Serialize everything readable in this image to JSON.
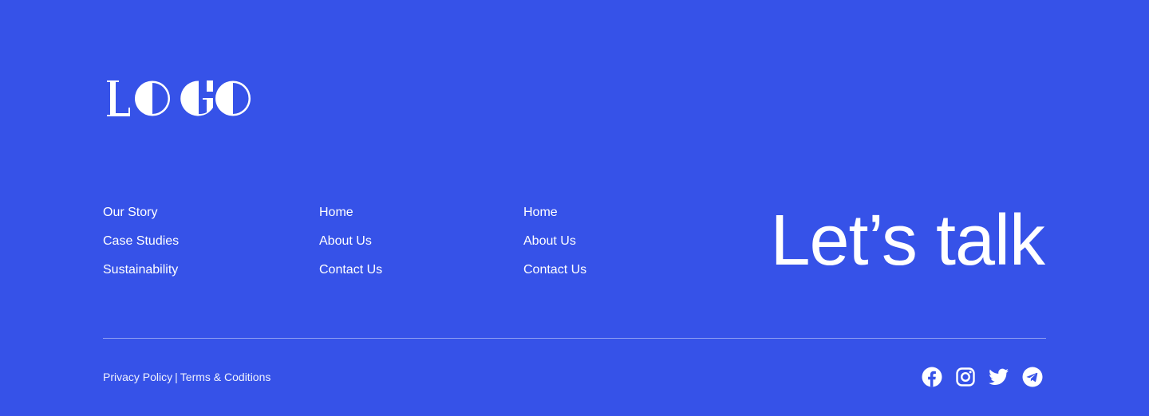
{
  "logo": {
    "text": "LOGO"
  },
  "nav": {
    "columns": [
      [
        "Our Story",
        "Case Studies",
        "Sustainability"
      ],
      [
        "Home",
        "About Us",
        "Contact Us"
      ],
      [
        "Home",
        "About Us",
        "Contact Us"
      ]
    ]
  },
  "cta": {
    "label": "Let’s talk"
  },
  "legal": {
    "privacy": "Privacy Policy",
    "separator": "|",
    "terms": "Terms & Coditions"
  },
  "social": [
    "facebook-icon",
    "instagram-icon",
    "twitter-icon",
    "telegram-icon"
  ],
  "colors": {
    "background": "#3652E8",
    "text": "#FFFFFF"
  }
}
